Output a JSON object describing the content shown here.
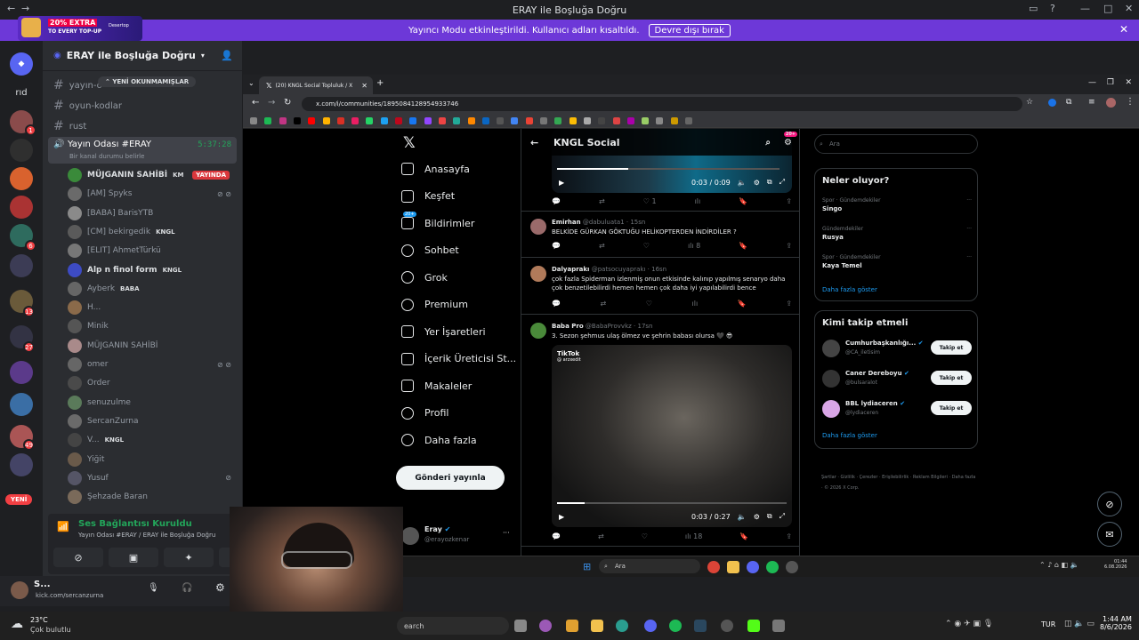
{
  "window": {
    "title": "ERAY ile Boşluğa Doğru"
  },
  "streamer_mode": {
    "text": "Yayıncı Modu etkinleştirildi. Kullanıcı adları kısaltıldı.",
    "button": "Devre dışı bırak"
  },
  "promo": {
    "line1": "20% EXTRA",
    "line2": "TO EVERY TOP-UP",
    "brand": "Desertop"
  },
  "server": {
    "name": "ERAY ile Boşluğa Doğru",
    "unread_pill": "YENİ OKUNMAMIŞLAR"
  },
  "rail": {
    "labels": [
      "rıd"
    ],
    "badges": [
      "1",
      "6",
      "13",
      "27",
      "49"
    ],
    "new_badge": "YENİ"
  },
  "channels": [
    {
      "name": "yayın-ö"
    },
    {
      "name": "oyun-kodlar"
    },
    {
      "name": "rust"
    }
  ],
  "voice_channel": {
    "name": "Yayın Odası #ERAY",
    "timer": "5:37:28",
    "status_hint": "Bir kanal durumu belirle"
  },
  "voice_users": [
    {
      "name": "MÜJGANIN SAHİBİ",
      "tag": "KM",
      "live": "YAYINDA"
    },
    {
      "name": "[AM] Spyks"
    },
    {
      "name": "[BABA] BarisYTB"
    },
    {
      "name": "[CM] bekirgedik",
      "tag": "KNGL"
    },
    {
      "name": "[ELIT] AhmetTürkü"
    },
    {
      "name": "Alp n finol form",
      "tag": "KNGL"
    },
    {
      "name": "Ayberk",
      "tag": "BABA"
    },
    {
      "name": "H..."
    },
    {
      "name": "Minik"
    },
    {
      "name": "MÜJGANIN SAHİBİ"
    },
    {
      "name": "omer"
    },
    {
      "name": "Order"
    },
    {
      "name": "senuzulme"
    },
    {
      "name": "SercanZurna"
    },
    {
      "name": "V...",
      "tag": "KNGL"
    },
    {
      "name": "Yiğit"
    },
    {
      "name": "Yusuf"
    },
    {
      "name": "Şehzade Baran"
    }
  ],
  "voice_panel": {
    "status": "Ses Bağlantısı Kuruldu",
    "location": "Yayın Odası #ERAY / ERAY ile Boşluğa Doğru"
  },
  "user_panel": {
    "name": "S...",
    "sub": "kick.com/sercanzurna"
  },
  "browser": {
    "tab_title": "(20) KNGL Social Topluluk / X",
    "url": "x.com/i/communities/1895084128954933746"
  },
  "x_nav": {
    "items": [
      "Anasayfa",
      "Keşfet",
      "Bildirimler",
      "Sohbet",
      "Grok",
      "Premium",
      "Yer İşaretleri",
      "İçerik Üreticisi St...",
      "Makaleler",
      "Profil",
      "Daha fazla"
    ],
    "notif_badge": "20+",
    "post_button": "Gönderi yayınla",
    "account_name": "Eray",
    "account_handle": "@erayozkenar"
  },
  "timeline": {
    "header": "KNGL Social",
    "header_badge": "20+",
    "video1": {
      "time": "0:03 / 0:09",
      "likes": "1"
    },
    "tweets": [
      {
        "author": "Emirhan",
        "handle": "@dabuluata1",
        "time": "15sn",
        "text": "BELKİDE GÜRKAN GÖKTUĞU HELİKOPTERDEN İNDİRDİLER ?",
        "views": "8"
      },
      {
        "author": "Dalyaprakı",
        "handle": "@patsocuyaprakı",
        "time": "16sn",
        "text": "çok fazla Spiderman izlenmiş onun etkisinde kalınıp yapılmış senaryo daha çok benzetilebilirdi hemen hemen çok daha iyi yapılabilirdi bence"
      },
      {
        "author": "Baba Pro",
        "handle": "@BabaProvvkz",
        "time": "17sn",
        "text": "3. Sezon şehmus ulaş  ölmez ve şehrin babası olursa 🖤 😎",
        "video_time": "0:03 / 0:27",
        "views": "18",
        "watermark": "TikTok",
        "watermark_user": "@ arzxedit"
      }
    ]
  },
  "right": {
    "search_placeholder": "Ara",
    "trends_title": "Neler oluyor?",
    "trends": [
      {
        "category": "Spor · Gündemdekiler",
        "name": "Singo"
      },
      {
        "category": "Gündemdekiler",
        "name": "Rusya"
      },
      {
        "category": "Spor · Gündemdekiler",
        "name": "Kaya Temel"
      }
    ],
    "trends_more": "Daha fazla göster",
    "follow_title": "Kimi takip etmeli",
    "follow": [
      {
        "name": "Cumhurbaşkanlığı...",
        "handle": "@CA_iletisim",
        "button": "Takip et"
      },
      {
        "name": "Caner Dereboyu",
        "handle": "@bulsaralot",
        "button": "Takip et"
      },
      {
        "name": "BBL lydiaceren",
        "handle": "@lydiaceren",
        "button": "Takip et"
      }
    ],
    "follow_more": "Daha fazla göster",
    "footer": "Şartlar · Gizlilik · Çerezler · Erişilebilirlik · Reklam Bilgileri · Daha fazla · © 2026 X Corp."
  },
  "taskbar_inner": {
    "search": "Ara",
    "time": "01:44",
    "date": "6.08.2026"
  },
  "taskbar_outer": {
    "weather_temp": "23°C",
    "weather_desc": "Çok bulutlu",
    "search": "earch",
    "lang": "TUR",
    "time": "1:44 AM",
    "date": "8/6/2026"
  },
  "colors": {
    "discord_bg": "#2b2d31",
    "streamer_bar": "#6d38d8",
    "x_bg": "#000000",
    "x_blue": "#1d9bf0",
    "live_red": "#da373c",
    "online_green": "#23a55a"
  }
}
